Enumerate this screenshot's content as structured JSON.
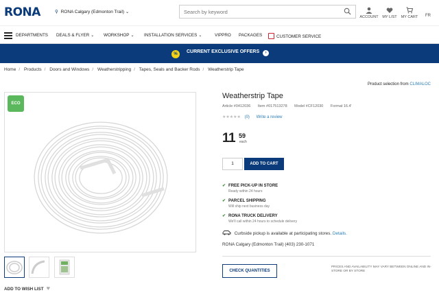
{
  "header": {
    "logo": "RONA",
    "store": "RONA Calgary (Edmonton Trail)",
    "search_placeholder": "Search by keyword",
    "account": "ACCOUNT",
    "my_list": "MY LIST",
    "my_cart": "MY CART",
    "lang": "FR"
  },
  "nav": {
    "departments": "DEPARTMENTS",
    "deals": "DEALS & FLYER",
    "workshop": "WORKSHOP",
    "installation": "INSTALLATION SERVICES",
    "vippro": "VIPPRO",
    "packages": "PACKAGES",
    "customer_service": "CUSTOMER SERVICE"
  },
  "banner": {
    "text": "CURRENT EXCLUSIVE OFFERS"
  },
  "breadcrumb": [
    "Home",
    "Products",
    "Doors and Windows",
    "Weatherstripping",
    "Tapes, Seals and Backer Rods",
    "Weatherstrip Tape"
  ],
  "selection": {
    "text": "Product selection from",
    "brand": "CLIMALOC"
  },
  "image": {
    "badge": "ECO"
  },
  "product": {
    "title": "Weatherstrip Tape",
    "article": "Article #0412036",
    "item": "Item #017513278",
    "model": "Model #CF12030",
    "format": "Format 16.4'",
    "stars": "★★★★★",
    "reviews": "(0)",
    "write_review": "Write a review",
    "price_dollars": "11",
    "price_cents": "59",
    "price_unit": "each",
    "qty": "1",
    "add_to_cart": "ADD TO CART"
  },
  "shipping": [
    {
      "title": "FREE PICK-UP IN STORE",
      "sub": "Ready within 24 hours"
    },
    {
      "title": "PARCEL SHIPPING",
      "sub": "Will ship next business day"
    },
    {
      "title": "RONA TRUCK DELIVERY",
      "sub": "We'll call within 24 hours to schedule delivery"
    }
  ],
  "curbside": {
    "text": "Curbside pickup is available at participating stores.",
    "link": "Details."
  },
  "store_info": "RONA Calgary (Edmonton Trail)  (403) 230-1071",
  "check_quantities": "CHECK QUANTITIES",
  "disclaimer": "Prices and availability may vary between online and in-store or by store",
  "wish_list": "ADD TO WISH LIST",
  "colors": {
    "brand": "#0b3b7a",
    "accent": "#f3d117",
    "eco": "#5cb85c",
    "link": "#2a7db8",
    "check": "#3a8d3a"
  }
}
